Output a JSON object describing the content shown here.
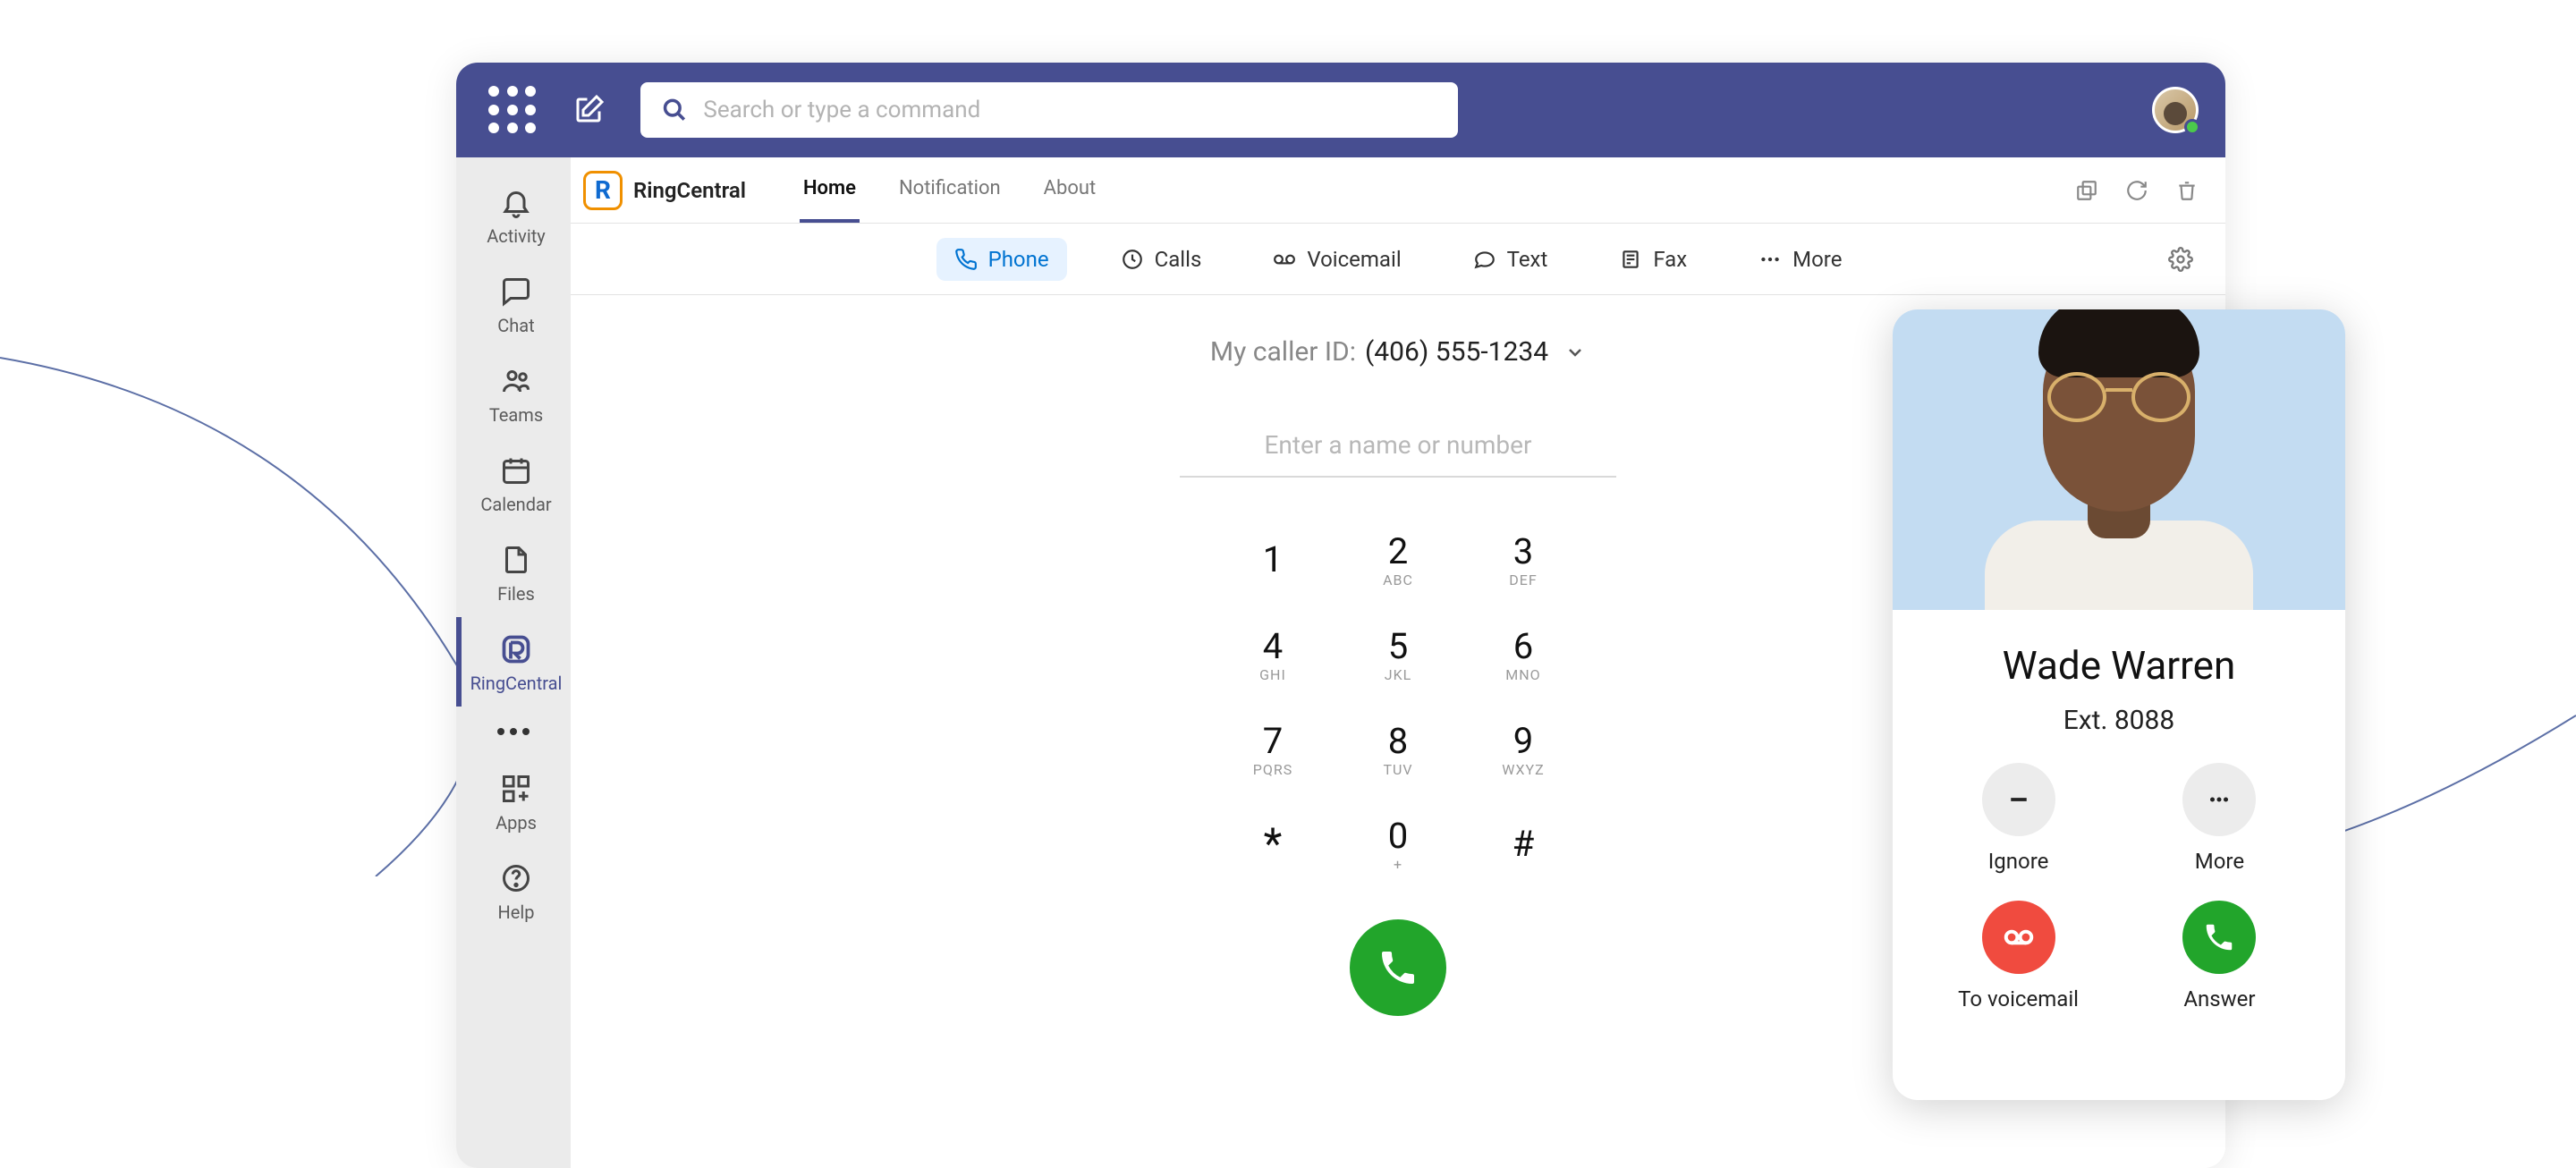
{
  "titlebar": {
    "search_placeholder": "Search or type a command"
  },
  "leftnav": {
    "items": [
      {
        "label": "Activity"
      },
      {
        "label": "Chat"
      },
      {
        "label": "Teams"
      },
      {
        "label": "Calendar"
      },
      {
        "label": "Files"
      },
      {
        "label": "RingCentral"
      },
      {
        "label": "Apps"
      },
      {
        "label": "Help"
      }
    ]
  },
  "app_header": {
    "brand": "RingCentral",
    "tabs": [
      {
        "label": "Home"
      },
      {
        "label": "Notification"
      },
      {
        "label": "About"
      }
    ]
  },
  "subnav": {
    "items": [
      {
        "label": "Phone"
      },
      {
        "label": "Calls"
      },
      {
        "label": "Voicemail"
      },
      {
        "label": "Text"
      },
      {
        "label": "Fax"
      },
      {
        "label": "More"
      }
    ]
  },
  "dialer": {
    "caller_label": "My caller ID:",
    "caller_value": "(406) 555-1234",
    "input_placeholder": "Enter a name or number",
    "keys": [
      {
        "d": "1",
        "s": ""
      },
      {
        "d": "2",
        "s": "ABC"
      },
      {
        "d": "3",
        "s": "DEF"
      },
      {
        "d": "4",
        "s": "GHI"
      },
      {
        "d": "5",
        "s": "JKL"
      },
      {
        "d": "6",
        "s": "MNO"
      },
      {
        "d": "7",
        "s": "PQRS"
      },
      {
        "d": "8",
        "s": "TUV"
      },
      {
        "d": "9",
        "s": "WXYZ"
      },
      {
        "d": "*",
        "s": ""
      },
      {
        "d": "0",
        "s": "+"
      },
      {
        "d": "#",
        "s": ""
      }
    ]
  },
  "incoming": {
    "name": "Wade Warren",
    "ext": "Ext. 8088",
    "actions": {
      "ignore": "Ignore",
      "more": "More",
      "to_vm": "To voicemail",
      "answer": "Answer"
    }
  }
}
